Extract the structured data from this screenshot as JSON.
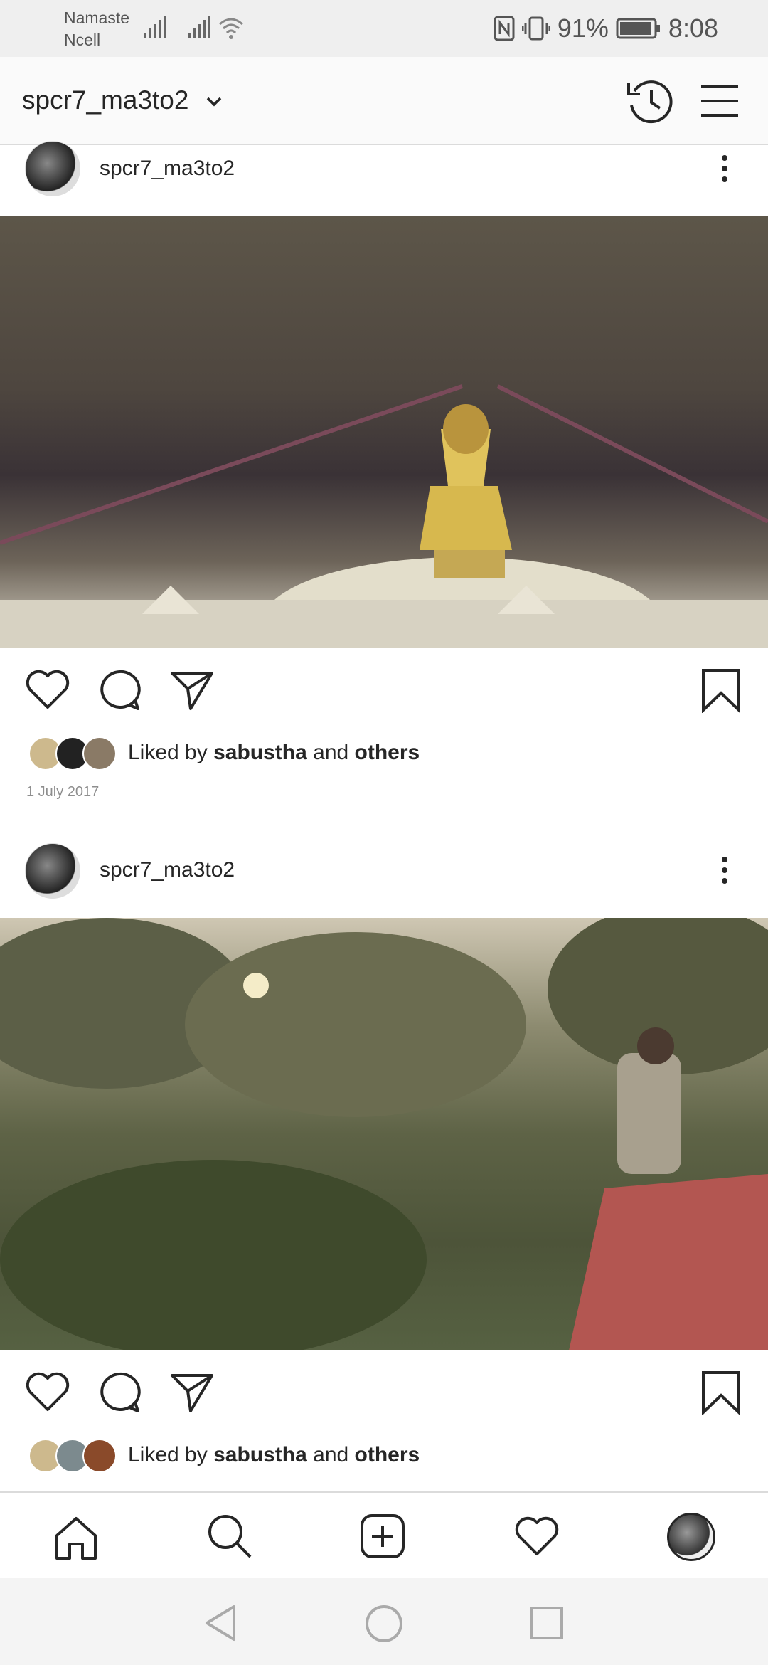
{
  "status_bar": {
    "carrier_line1": "Namaste",
    "carrier_line2": "Ncell",
    "battery": "91%",
    "time": "8:08"
  },
  "header": {
    "username": "spcr7_ma3to2"
  },
  "posts": [
    {
      "username": "spcr7_ma3to2",
      "liked_prefix": "Liked by ",
      "liked_user": "sabustha",
      "liked_and": " and ",
      "liked_others": "others",
      "date": "1 July 2017"
    },
    {
      "username": "spcr7_ma3to2",
      "liked_prefix": "Liked by ",
      "liked_user": "sabustha",
      "liked_and": " and ",
      "liked_others": "others"
    }
  ],
  "icons": {
    "status": [
      "signal-icon",
      "signal-icon",
      "wifi-icon",
      "nfc-icon",
      "vibrate-icon",
      "battery-icon"
    ],
    "header": [
      "chevron-down-icon",
      "history-icon",
      "menu-icon"
    ],
    "post_actions": [
      "heart-icon",
      "comment-icon",
      "share-icon",
      "bookmark-icon"
    ],
    "nav": [
      "home-icon",
      "search-icon",
      "add-post-icon",
      "activity-heart-icon",
      "profile-avatar"
    ],
    "android": [
      "back-icon",
      "home-circle-icon",
      "recents-icon"
    ]
  }
}
